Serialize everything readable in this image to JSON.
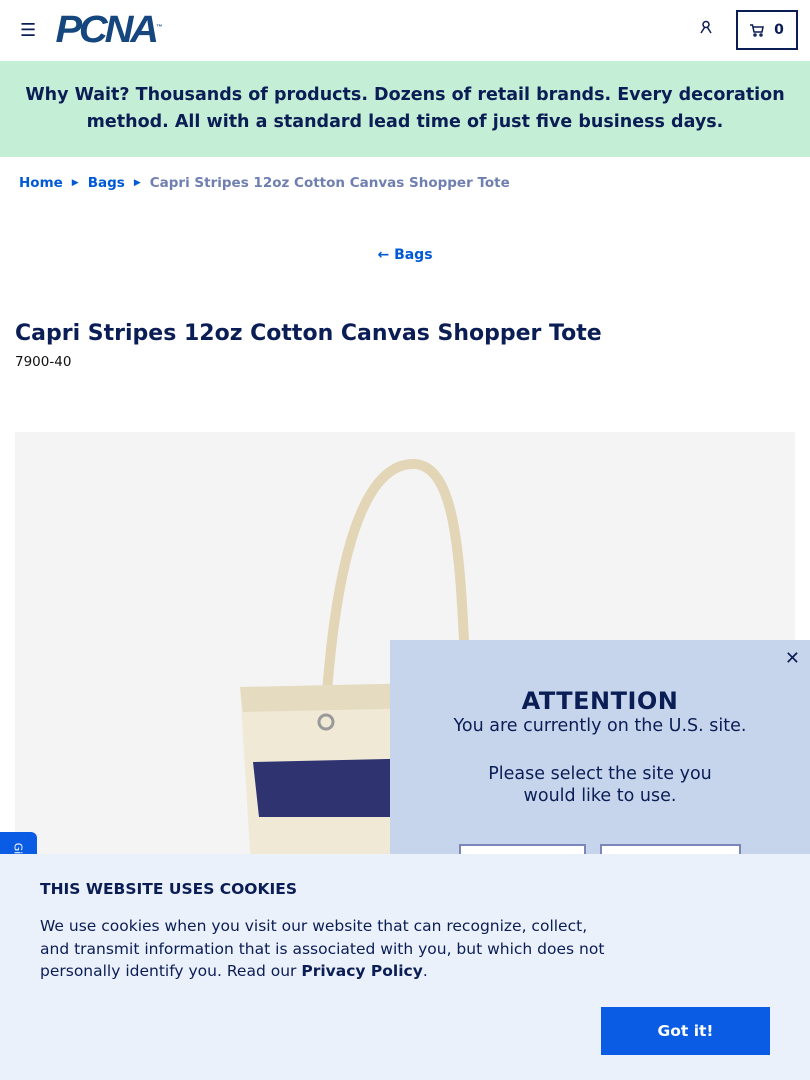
{
  "header": {
    "logo": "PCNA",
    "trademark": "™",
    "cart_count": "0"
  },
  "banner": "Why Wait? Thousands of products. Dozens of retail brands. Every decoration method. All with a standard lead time of just five business days.",
  "breadcrumb": [
    "Home",
    "Bags",
    "Capri Stripes 12oz Cotton Canvas Shopper Tote"
  ],
  "back_link": "Bags",
  "product": {
    "title": "Capri Stripes 12oz Cotton Canvas Shopper Tote",
    "sku": "7900-40"
  },
  "popup": {
    "title": "ATTENTION",
    "line1": "You are currently on the U.S. site.",
    "line2": "Please select the site you would like to use."
  },
  "side_tab": "Gi",
  "cookie": {
    "title": "THIS WEBSITE USES COOKIES",
    "text": "We use cookies when you visit our website that can recognize, collect, and transmit information that is associated with you, but which does not personally identify you. Read our ",
    "link": "Privacy Policy",
    "end": ".",
    "button": "Got it!"
  }
}
